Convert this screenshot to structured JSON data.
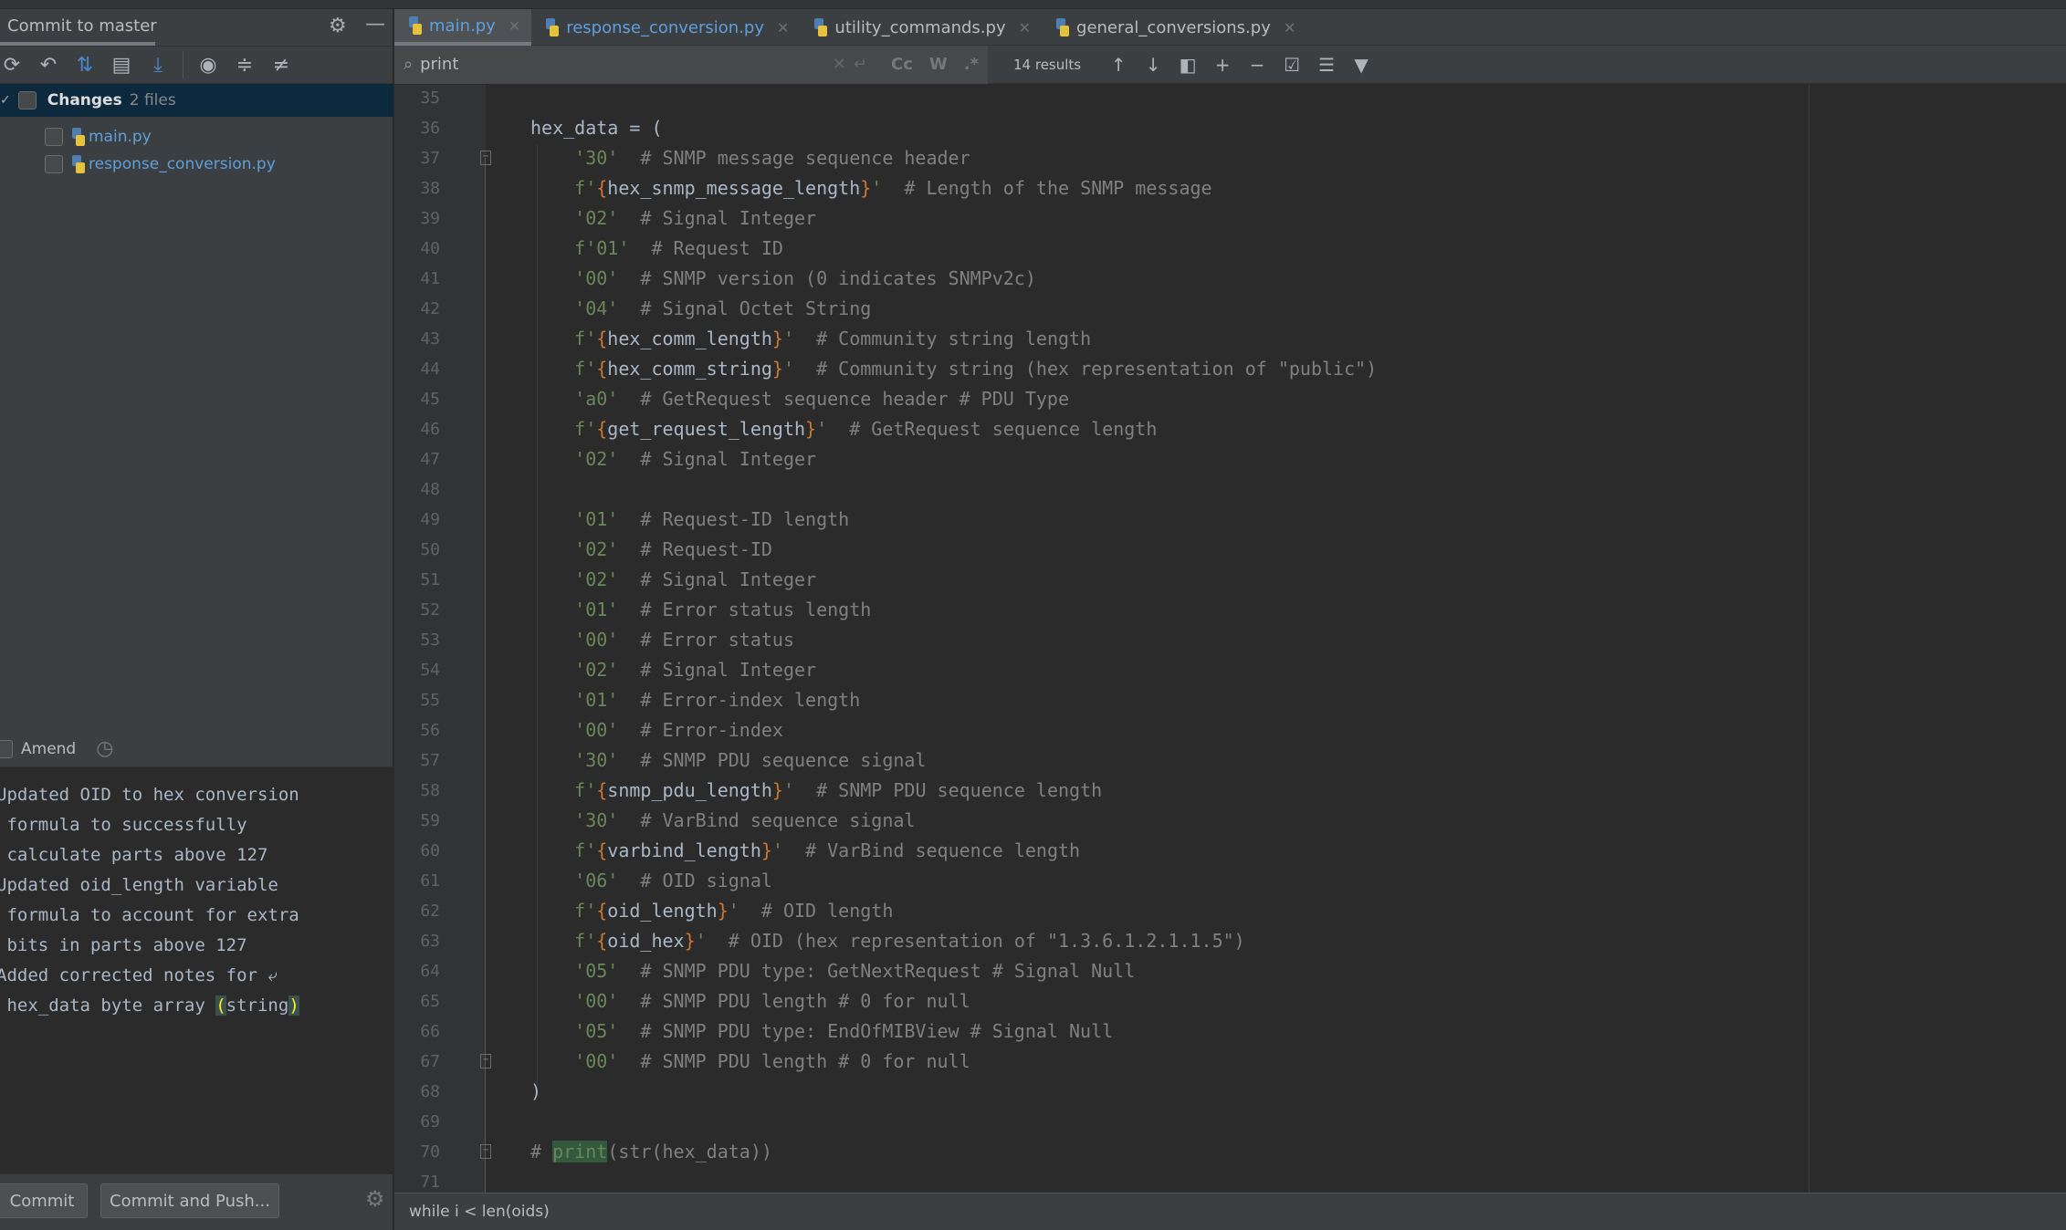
{
  "left_panel": {
    "title": "Commit to master",
    "changes_label": "Changes",
    "changes_count": "2 files",
    "files": [
      "main.py",
      "response_conversion.py"
    ],
    "amend_label": "Amend",
    "commit_message": [
      "Updated OID to hex conversion",
      " formula to successfully",
      " calculate parts above 127",
      "Updated oid_length variable",
      " formula to account for extra",
      " bits in parts above 127",
      "Added corrected notes for ⤶",
      " hex_data byte array ",
      "(",
      "string",
      ")"
    ],
    "commit_button": "Commit",
    "commit_push_button": "Commit and Push..."
  },
  "tabs": [
    {
      "label": "main.py",
      "active": true
    },
    {
      "label": "response_conversion.py"
    },
    {
      "label": "utility_commands.py"
    },
    {
      "label": "general_conversions.py"
    }
  ],
  "search": {
    "query": "print",
    "results": "14 results",
    "opt_case": "Cc",
    "opt_words": "W",
    "opt_regex": ".*"
  },
  "editor": {
    "lines": [
      {
        "n": "35",
        "t": []
      },
      {
        "n": "36",
        "t": [
          [
            "v",
            "hex_data = ("
          ]
        ]
      },
      {
        "n": "37",
        "t": [
          [
            "s",
            "    '30'"
          ],
          [
            "c",
            "  # SNMP message sequence header"
          ]
        ],
        "fold": true
      },
      {
        "n": "38",
        "t": [
          [
            "s",
            "    f'"
          ],
          [
            "b",
            "{"
          ],
          [
            "v",
            "hex_snmp_message_length"
          ],
          [
            "b",
            "}"
          ],
          [
            "s",
            "'"
          ],
          [
            "c",
            "  # Length of the SNMP message"
          ]
        ]
      },
      {
        "n": "39",
        "t": [
          [
            "s",
            "    '02'"
          ],
          [
            "c",
            "  # Signal Integer"
          ]
        ]
      },
      {
        "n": "40",
        "t": [
          [
            "s",
            "    f'01'"
          ],
          [
            "c",
            "  # Request ID"
          ]
        ]
      },
      {
        "n": "41",
        "t": [
          [
            "s",
            "    '00'"
          ],
          [
            "c",
            "  # SNMP version (0 indicates SNMPv2c)"
          ]
        ]
      },
      {
        "n": "42",
        "t": [
          [
            "s",
            "    '04'"
          ],
          [
            "c",
            "  # Signal Octet String"
          ]
        ]
      },
      {
        "n": "43",
        "t": [
          [
            "s",
            "    f'"
          ],
          [
            "b",
            "{"
          ],
          [
            "v",
            "hex_comm_length"
          ],
          [
            "b",
            "}"
          ],
          [
            "s",
            "'"
          ],
          [
            "c",
            "  # Community string length"
          ]
        ]
      },
      {
        "n": "44",
        "t": [
          [
            "s",
            "    f'"
          ],
          [
            "b",
            "{"
          ],
          [
            "v",
            "hex_comm_string"
          ],
          [
            "b",
            "}"
          ],
          [
            "s",
            "'"
          ],
          [
            "c",
            "  # Community string (hex representation of \"public\")"
          ]
        ]
      },
      {
        "n": "45",
        "t": [
          [
            "s",
            "    'a0'"
          ],
          [
            "c",
            "  # GetRequest sequence header # PDU Type"
          ]
        ]
      },
      {
        "n": "46",
        "t": [
          [
            "s",
            "    f'"
          ],
          [
            "b",
            "{"
          ],
          [
            "v",
            "get_request_length"
          ],
          [
            "b",
            "}"
          ],
          [
            "s",
            "'"
          ],
          [
            "c",
            "  # GetRequest sequence length"
          ]
        ]
      },
      {
        "n": "47",
        "t": [
          [
            "s",
            "    '02'"
          ],
          [
            "c",
            "  # Signal Integer"
          ]
        ]
      },
      {
        "n": "48",
        "t": []
      },
      {
        "n": "49",
        "t": [
          [
            "s",
            "    '01'"
          ],
          [
            "c",
            "  # Request-ID length"
          ]
        ]
      },
      {
        "n": "50",
        "t": [
          [
            "s",
            "    '02'"
          ],
          [
            "c",
            "  # Request-ID"
          ]
        ]
      },
      {
        "n": "51",
        "t": [
          [
            "s",
            "    '02'"
          ],
          [
            "c",
            "  # Signal Integer"
          ]
        ]
      },
      {
        "n": "52",
        "t": [
          [
            "s",
            "    '01'"
          ],
          [
            "c",
            "  # Error status length"
          ]
        ]
      },
      {
        "n": "53",
        "t": [
          [
            "s",
            "    '00'"
          ],
          [
            "c",
            "  # Error status"
          ]
        ]
      },
      {
        "n": "54",
        "t": [
          [
            "s",
            "    '02'"
          ],
          [
            "c",
            "  # Signal Integer"
          ]
        ]
      },
      {
        "n": "55",
        "t": [
          [
            "s",
            "    '01'"
          ],
          [
            "c",
            "  # Error-index length"
          ]
        ]
      },
      {
        "n": "56",
        "t": [
          [
            "s",
            "    '00'"
          ],
          [
            "c",
            "  # Error-index"
          ]
        ]
      },
      {
        "n": "57",
        "t": [
          [
            "s",
            "    '30'"
          ],
          [
            "c",
            "  # SNMP PDU sequence signal"
          ]
        ]
      },
      {
        "n": "58",
        "t": [
          [
            "s",
            "    f'"
          ],
          [
            "b",
            "{"
          ],
          [
            "v",
            "snmp_pdu_length"
          ],
          [
            "b",
            "}"
          ],
          [
            "s",
            "'"
          ],
          [
            "c",
            "  # SNMP PDU sequence length"
          ]
        ]
      },
      {
        "n": "59",
        "t": [
          [
            "s",
            "    '30'"
          ],
          [
            "c",
            "  # VarBind sequence signal"
          ]
        ]
      },
      {
        "n": "60",
        "t": [
          [
            "s",
            "    f'"
          ],
          [
            "b",
            "{"
          ],
          [
            "v",
            "varbind_length"
          ],
          [
            "b",
            "}"
          ],
          [
            "s",
            "'"
          ],
          [
            "c",
            "  # VarBind sequence length"
          ]
        ]
      },
      {
        "n": "61",
        "t": [
          [
            "s",
            "    '06'"
          ],
          [
            "c",
            "  # OID signal"
          ]
        ]
      },
      {
        "n": "62",
        "t": [
          [
            "s",
            "    f'"
          ],
          [
            "b",
            "{"
          ],
          [
            "v",
            "oid_length"
          ],
          [
            "b",
            "}"
          ],
          [
            "s",
            "'"
          ],
          [
            "c",
            "  # OID length"
          ]
        ]
      },
      {
        "n": "63",
        "t": [
          [
            "s",
            "    f'"
          ],
          [
            "b",
            "{"
          ],
          [
            "v",
            "oid_hex"
          ],
          [
            "b",
            "}"
          ],
          [
            "s",
            "'"
          ],
          [
            "c",
            "  # OID (hex representation of \"1.3.6.1.2.1.1.5\")"
          ]
        ]
      },
      {
        "n": "64",
        "t": [
          [
            "s",
            "    '05'"
          ],
          [
            "c",
            "  # SNMP PDU type: GetNextRequest # Signal Null"
          ]
        ]
      },
      {
        "n": "65",
        "t": [
          [
            "s",
            "    '00'"
          ],
          [
            "c",
            "  # SNMP PDU length # 0 for null"
          ]
        ]
      },
      {
        "n": "66",
        "t": [
          [
            "s",
            "    '05'"
          ],
          [
            "c",
            "  # SNMP PDU type: EndOfMIBView # Signal Null"
          ]
        ]
      },
      {
        "n": "67",
        "t": [
          [
            "s",
            "    '00'"
          ],
          [
            "c",
            "  # SNMP PDU length # 0 for null"
          ]
        ],
        "fold": true
      },
      {
        "n": "68",
        "t": [
          [
            "v",
            ")"
          ]
        ]
      },
      {
        "n": "69",
        "t": []
      },
      {
        "n": "70",
        "t": [
          [
            "c",
            "# "
          ],
          [
            "h",
            "print"
          ],
          [
            "c",
            "(str(hex_data))"
          ]
        ],
        "fold": true
      },
      {
        "n": "71",
        "t": []
      }
    ]
  },
  "status": {
    "breadcrumb": "while i < len(oids)"
  },
  "colors": {
    "string": "#6a8759",
    "comment": "#808080",
    "brace": "#cc7832",
    "identifier": "#a9b7c6",
    "selection": "#0d293e",
    "match": "#32593d"
  }
}
